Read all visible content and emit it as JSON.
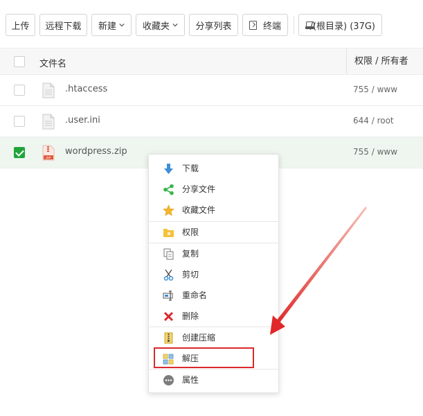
{
  "toolbar": {
    "upload": "上传",
    "remote_download": "远程下载",
    "new": "新建",
    "favorites": "收藏夹",
    "share_list": "分享列表",
    "terminal": "终端",
    "path": "/(根目录) (37G)"
  },
  "table": {
    "columns": [
      "文件名",
      "权限 / 所有者"
    ],
    "rows": [
      {
        "name": ".htaccess",
        "perm": "755 / www",
        "selected": false
      },
      {
        "name": ".user.ini",
        "perm": "644 / root",
        "selected": false
      },
      {
        "name": "wordpress.zip",
        "perm": "755 / www",
        "selected": true
      }
    ]
  },
  "context_menu": {
    "items": [
      {
        "label": "下载",
        "icon": "download-icon"
      },
      {
        "label": "分享文件",
        "icon": "share-icon"
      },
      {
        "label": "收藏文件",
        "icon": "star-icon"
      },
      {
        "label": "权限",
        "icon": "folder-permission-icon"
      },
      {
        "label": "复制",
        "icon": "copy-icon"
      },
      {
        "label": "剪切",
        "icon": "scissors-icon"
      },
      {
        "label": "重命名",
        "icon": "rename-icon"
      },
      {
        "label": "删除",
        "icon": "delete-icon"
      },
      {
        "label": "创建压缩",
        "icon": "compress-icon"
      },
      {
        "label": "解压",
        "icon": "extract-icon"
      },
      {
        "label": "属性",
        "icon": "properties-icon"
      }
    ],
    "highlighted": "解压"
  },
  "colors": {
    "accent_green": "#20a53a",
    "selected_row": "#eef6ef",
    "annotation_red": "#d9292b"
  }
}
